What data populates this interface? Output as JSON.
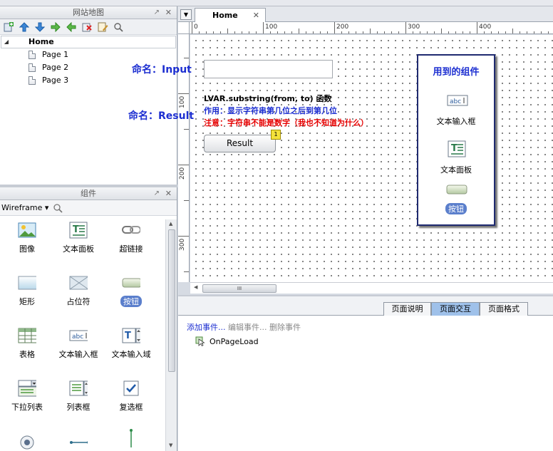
{
  "sitemap_panel": {
    "title": "网站地图",
    "pin_glyph": "↗",
    "close_glyph": "✕",
    "home": "Home",
    "pages": [
      "Page 1",
      "Page 2",
      "Page 3"
    ]
  },
  "widgets_panel": {
    "title": "组件",
    "library": "Wireframe ▾",
    "items": [
      {
        "label": "图像",
        "icon": "image-icon"
      },
      {
        "label": "文本面板",
        "icon": "text-panel-icon"
      },
      {
        "label": "超链接",
        "icon": "hyperlink-icon"
      },
      {
        "label": "矩形",
        "icon": "rectangle-icon"
      },
      {
        "label": "占位符",
        "icon": "placeholder-icon"
      },
      {
        "label": "按钮",
        "icon": "button-icon"
      },
      {
        "label": "表格",
        "icon": "table-icon"
      },
      {
        "label": "文本输入框",
        "icon": "text-input-icon"
      },
      {
        "label": "文本输入域",
        "icon": "text-area-icon"
      },
      {
        "label": "下拉列表",
        "icon": "dropdown-list-icon"
      },
      {
        "label": "列表框",
        "icon": "list-box-icon"
      },
      {
        "label": "复选框",
        "icon": "checkbox-icon"
      },
      {
        "label": "",
        "icon": "radio-icon"
      },
      {
        "label": "",
        "icon": "horizontal-line-icon"
      },
      {
        "label": "",
        "icon": "vertical-line-icon"
      }
    ]
  },
  "editor": {
    "tab_label": "Home",
    "tab_close": "✕",
    "ruler_h": [
      "0",
      "100",
      "200",
      "300",
      "400"
    ],
    "ruler_v": [
      "100",
      "200",
      "300"
    ],
    "canvas": {
      "label_input": "命名：Input",
      "label_result": "命名：Result",
      "line1": "LVAR.substring(from, to) 函数",
      "line2": "作用：显示字符串第几位之后到第几位",
      "line3": "注意：字符串不能是数字（我也不知道为什么）",
      "button_label": "Result",
      "badge": "1",
      "used_title": "用到的组件",
      "used_items": [
        "文本输入框",
        "文本面板",
        "按钮"
      ],
      "used_input_icon_text": "abc"
    },
    "hscroll_grip": "III"
  },
  "bottom_panel": {
    "tabs": [
      "页面说明",
      "页面交互",
      "页面格式"
    ],
    "active_tab": 1,
    "add_event": "添加事件...",
    "edit_event": "编辑事件...",
    "delete_event": "删除事件",
    "event_name": "OnPageLoad"
  },
  "colors": {
    "label_blue": "#1d2fd1",
    "warning_red": "#e60000",
    "active_tab": "#9fc1ea",
    "box_border": "#1f2a70"
  }
}
